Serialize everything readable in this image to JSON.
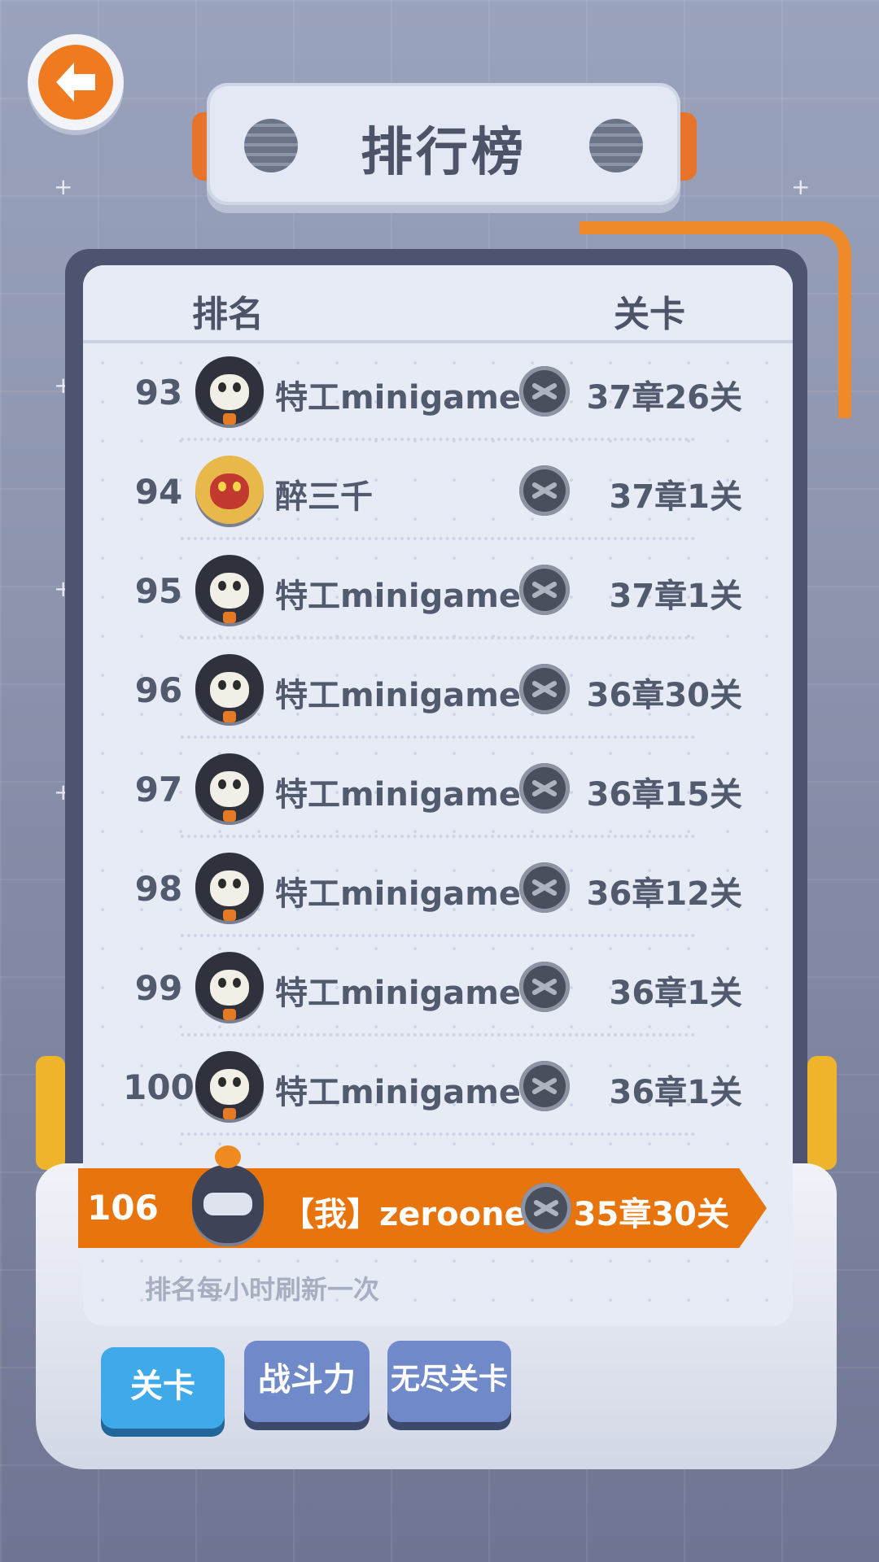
{
  "header": {
    "title": "排行榜"
  },
  "columns": {
    "rank_label": "排名",
    "level_label": "关卡"
  },
  "rows": [
    {
      "rank": "93",
      "name": "特工minigame",
      "level": "37章26关",
      "avatar": "skull-agent"
    },
    {
      "rank": "94",
      "name": "醉三千",
      "level": "37章1关",
      "avatar": "gold-warrior"
    },
    {
      "rank": "95",
      "name": "特工minigame",
      "level": "37章1关",
      "avatar": "skull-agent"
    },
    {
      "rank": "96",
      "name": "特工minigame",
      "level": "36章30关",
      "avatar": "skull-agent"
    },
    {
      "rank": "97",
      "name": "特工minigame",
      "level": "36章15关",
      "avatar": "skull-agent"
    },
    {
      "rank": "98",
      "name": "特工minigame",
      "level": "36章12关",
      "avatar": "skull-agent"
    },
    {
      "rank": "99",
      "name": "特工minigame",
      "level": "36章1关",
      "avatar": "skull-agent"
    },
    {
      "rank": "100",
      "name": "特工minigame",
      "level": "36章1关",
      "avatar": "skull-agent"
    }
  ],
  "me": {
    "rank": "106",
    "name": "【我】zeroone",
    "level": "35章30关",
    "avatar": "pumpkin-robot"
  },
  "note": "排名每小时刷新一次",
  "tabs": [
    {
      "label": "关卡",
      "active": true
    },
    {
      "label": "战斗力",
      "active": false
    },
    {
      "label": "无尽关卡",
      "active": false
    }
  ],
  "colors": {
    "accent_orange": "#e8740e",
    "tab_active": "#3fa9ea",
    "tab_inactive": "#7089c9"
  },
  "icons": {
    "back": "arrow-left-icon",
    "rank_badge": "crossed-swords-icon"
  }
}
